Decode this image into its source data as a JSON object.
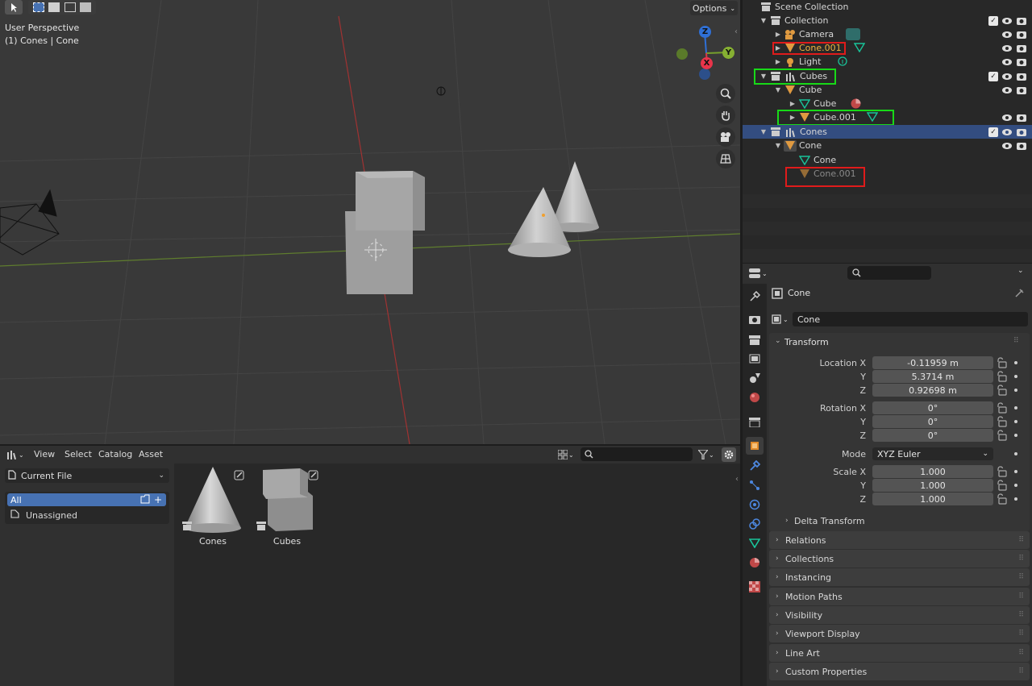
{
  "viewport": {
    "options_label": "Options",
    "overlay_line1": "User Perspective",
    "overlay_line2": "(1) Cones | Cone",
    "gizmo": {
      "z": "Z",
      "y": "Y",
      "x": "X"
    }
  },
  "outliner": {
    "rows": [
      {
        "label": "Scene Collection"
      },
      {
        "label": "Collection"
      },
      {
        "label": "Camera"
      },
      {
        "label": "Cone.001"
      },
      {
        "label": "Light"
      },
      {
        "label": "Cubes"
      },
      {
        "label": "Cube"
      },
      {
        "label": "Cube"
      },
      {
        "label": "Cube.001"
      },
      {
        "label": "Cones"
      },
      {
        "label": "Cone"
      },
      {
        "label": "Cone"
      },
      {
        "label": "Cone.001"
      }
    ],
    "highlight_colors": {
      "red": "#e01b1b",
      "green": "#18d918",
      "selected": "#334d80"
    }
  },
  "properties": {
    "search_placeholder": "",
    "object_name": "Cone",
    "datablock_name": "Cone",
    "transform": {
      "title": "Transform",
      "location_label": "Location X",
      "rotation_label": "Rotation X",
      "scale_label": "Scale X",
      "y_label": "Y",
      "z_label": "Z",
      "mode_label": "Mode",
      "mode_value": "XYZ Euler",
      "location": [
        "-0.11959 m",
        "5.3714 m",
        "0.92698 m"
      ],
      "rotation": [
        "0°",
        "0°",
        "0°"
      ],
      "scale": [
        "1.000",
        "1.000",
        "1.000"
      ],
      "delta": "Delta Transform"
    },
    "panels": [
      "Relations",
      "Collections",
      "Instancing",
      "Motion Paths",
      "Visibility",
      "Viewport Display",
      "Line Art",
      "Custom Properties"
    ]
  },
  "asset_browser": {
    "menus": [
      "View",
      "Select",
      "Catalog",
      "Asset"
    ],
    "library": "Current File",
    "catalogs": [
      "All",
      "Unassigned"
    ],
    "assets": [
      "Cones",
      "Cubes"
    ]
  }
}
